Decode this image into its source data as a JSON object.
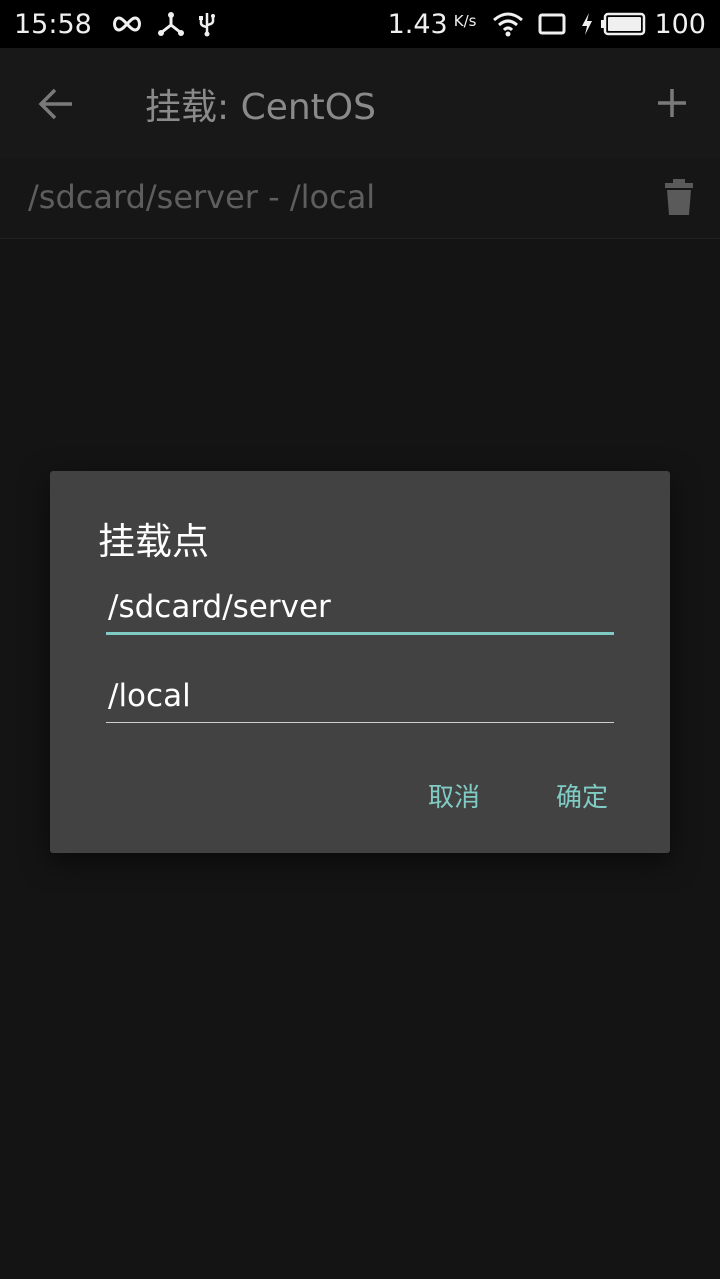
{
  "status_bar": {
    "time": "15:58",
    "net_speed": "1.43",
    "net_speed_unit": "K/s",
    "battery": "100",
    "icons": [
      "infinity-icon",
      "share-hub-icon",
      "usb-icon",
      "wifi-icon",
      "tablet-icon",
      "charging-bolt-icon",
      "battery-icon"
    ]
  },
  "toolbar": {
    "title": "挂载: CentOS",
    "back_icon": "arrow-left-icon",
    "add_icon": "plus-icon"
  },
  "mount_list": {
    "items": [
      {
        "label": "/sdcard/server - /local",
        "delete_icon": "trash-icon"
      }
    ]
  },
  "dialog": {
    "title": "挂载点",
    "source_value": "/sdcard/server",
    "target_value": "/local",
    "cancel_label": "取消",
    "ok_label": "确定"
  },
  "colors": {
    "accent": "#80cbc4",
    "dialog_bg": "#424242",
    "background": "#141414",
    "status_bar_bg": "#000000"
  }
}
